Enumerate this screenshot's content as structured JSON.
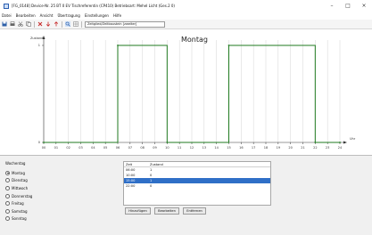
{
  "window": {
    "title": "[FG_0148] Device-Nr. 25 BT 0 EV Tischreferentin (CP410) Betriebsart: Mehel Licht (Ges.2 0)",
    "minimize": "–",
    "maximize": "□",
    "close": "×"
  },
  "menu": [
    "Datei",
    "Bearbeiten",
    "Ansicht",
    "Übertragung",
    "Einstellungen",
    "Hilfe"
  ],
  "toolbar": {
    "icons": [
      "save-icon",
      "print-icon",
      "cut-icon",
      "copy-icon",
      "delete-icon",
      "arrow-down-icon",
      "arrow-up-icon",
      "zoom-icon",
      "grid-icon"
    ],
    "select_value": "Zeitglied/Zeitbaustein [zweiter]"
  },
  "chart_data": {
    "type": "line",
    "title": "Montag",
    "ylabel": "Zustand",
    "xlabel": "Uhr",
    "x_ticks": [
      "00",
      "01",
      "02",
      "03",
      "04",
      "05",
      "06",
      "07",
      "08",
      "09",
      "10",
      "11",
      "12",
      "13",
      "14",
      "15",
      "16",
      "17",
      "18",
      "19",
      "20",
      "21",
      "22",
      "23",
      "24"
    ],
    "y_ticks": [
      "0",
      "1"
    ],
    "xlim": [
      0,
      24
    ],
    "ylim": [
      0,
      1
    ],
    "grid": true,
    "line_color": "#1f7a1f",
    "steps": [
      {
        "x": 0,
        "y": 0
      },
      {
        "x": 6,
        "y": 1
      },
      {
        "x": 10,
        "y": 0
      },
      {
        "x": 15,
        "y": 1
      },
      {
        "x": 22,
        "y": 0
      },
      {
        "x": 24,
        "y": 0
      }
    ]
  },
  "panel": {
    "weekday_label": "Wochentag",
    "weekdays": [
      "Montag",
      "Dienstag",
      "Mittwoch",
      "Donnerstag",
      "Freitag",
      "Samstag",
      "Sonntag"
    ],
    "selected_weekday": 0
  },
  "table": {
    "headers": {
      "time": "Zeit",
      "state": "Zustand"
    },
    "rows": [
      {
        "time": "06:00",
        "state": "1"
      },
      {
        "time": "10:00",
        "state": "0"
      },
      {
        "time": "15:00",
        "state": "1"
      },
      {
        "time": "22:00",
        "state": "0"
      }
    ],
    "selected_row": 2
  },
  "buttons": {
    "add": "Hinzufügen",
    "edit": "Bearbeiten",
    "remove": "Entfernen"
  }
}
